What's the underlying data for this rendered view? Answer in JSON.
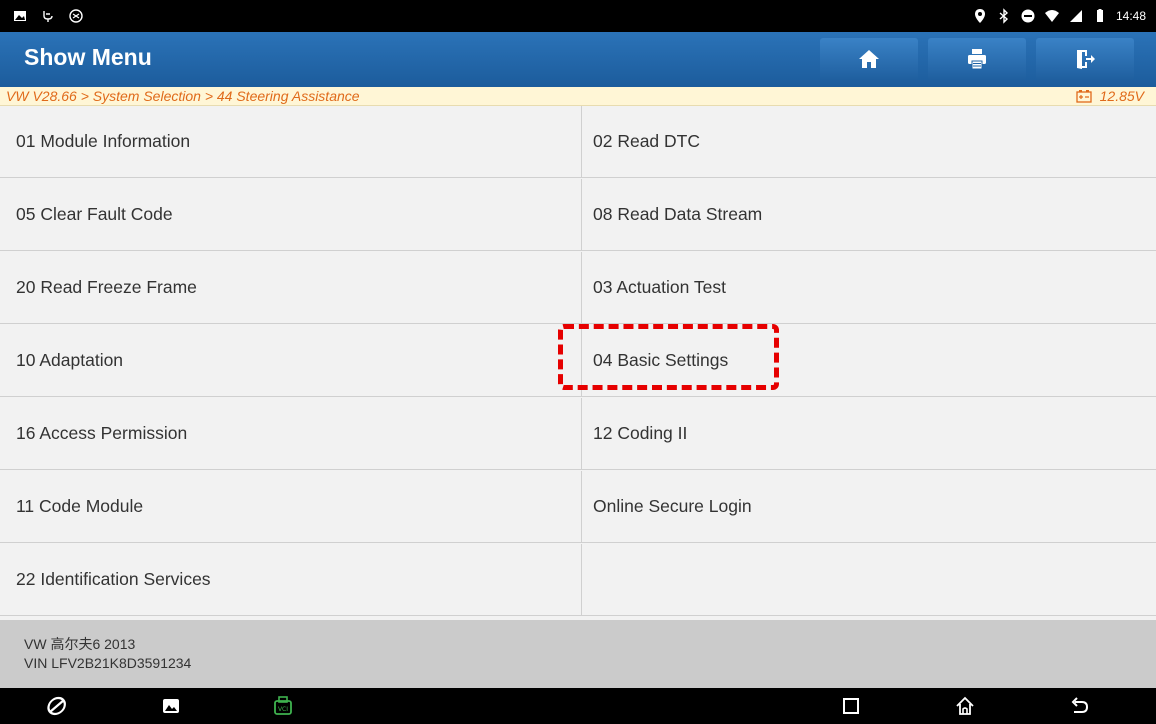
{
  "statusbar": {
    "time": "14:48"
  },
  "header": {
    "title": "Show Menu",
    "icons": [
      "home-icon",
      "print-icon",
      "exit-icon"
    ]
  },
  "breadcrumb": {
    "path": "VW V28.66 > System Selection > 44 Steering Assistance",
    "voltage": "12.85V"
  },
  "menu": {
    "left": [
      "01 Module Information",
      "05 Clear Fault Code",
      "20 Read Freeze Frame",
      "10 Adaptation",
      "16 Access Permission",
      "11 Code Module",
      "22 Identification Services"
    ],
    "right": [
      "02 Read DTC",
      "08 Read Data Stream",
      "03 Actuation Test",
      "04 Basic Settings",
      "12 Coding II",
      "Online Secure Login",
      ""
    ],
    "highlighted": "04 Basic Settings"
  },
  "vehicle": {
    "model": "VW 高尔夫6 2013",
    "vin": "VIN LFV2B21K8D3591234"
  },
  "colors": {
    "title_bar": "#1f63a6",
    "breadcrumb_text": "#e06a1a",
    "highlight": "#e60000"
  }
}
